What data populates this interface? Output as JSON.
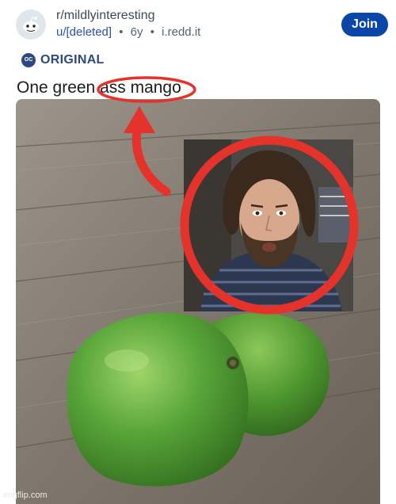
{
  "post_header": {
    "subreddit": "r/mildlyinteresting",
    "username": "u/[deleted]",
    "age": "6y",
    "separator": "•",
    "source": "i.redd.it",
    "join_label": "Join"
  },
  "flair": {
    "badge_text": "OC",
    "label": "ORIGINAL"
  },
  "post": {
    "title": "One green ass mango"
  },
  "watermark": "imgflip.com",
  "colors": {
    "join_bg": "#0a45a8",
    "username": "#2c4fae",
    "flair": "#2c4a7e",
    "annotation_red": "#e5322b",
    "mango_green": "#5aa63a"
  }
}
